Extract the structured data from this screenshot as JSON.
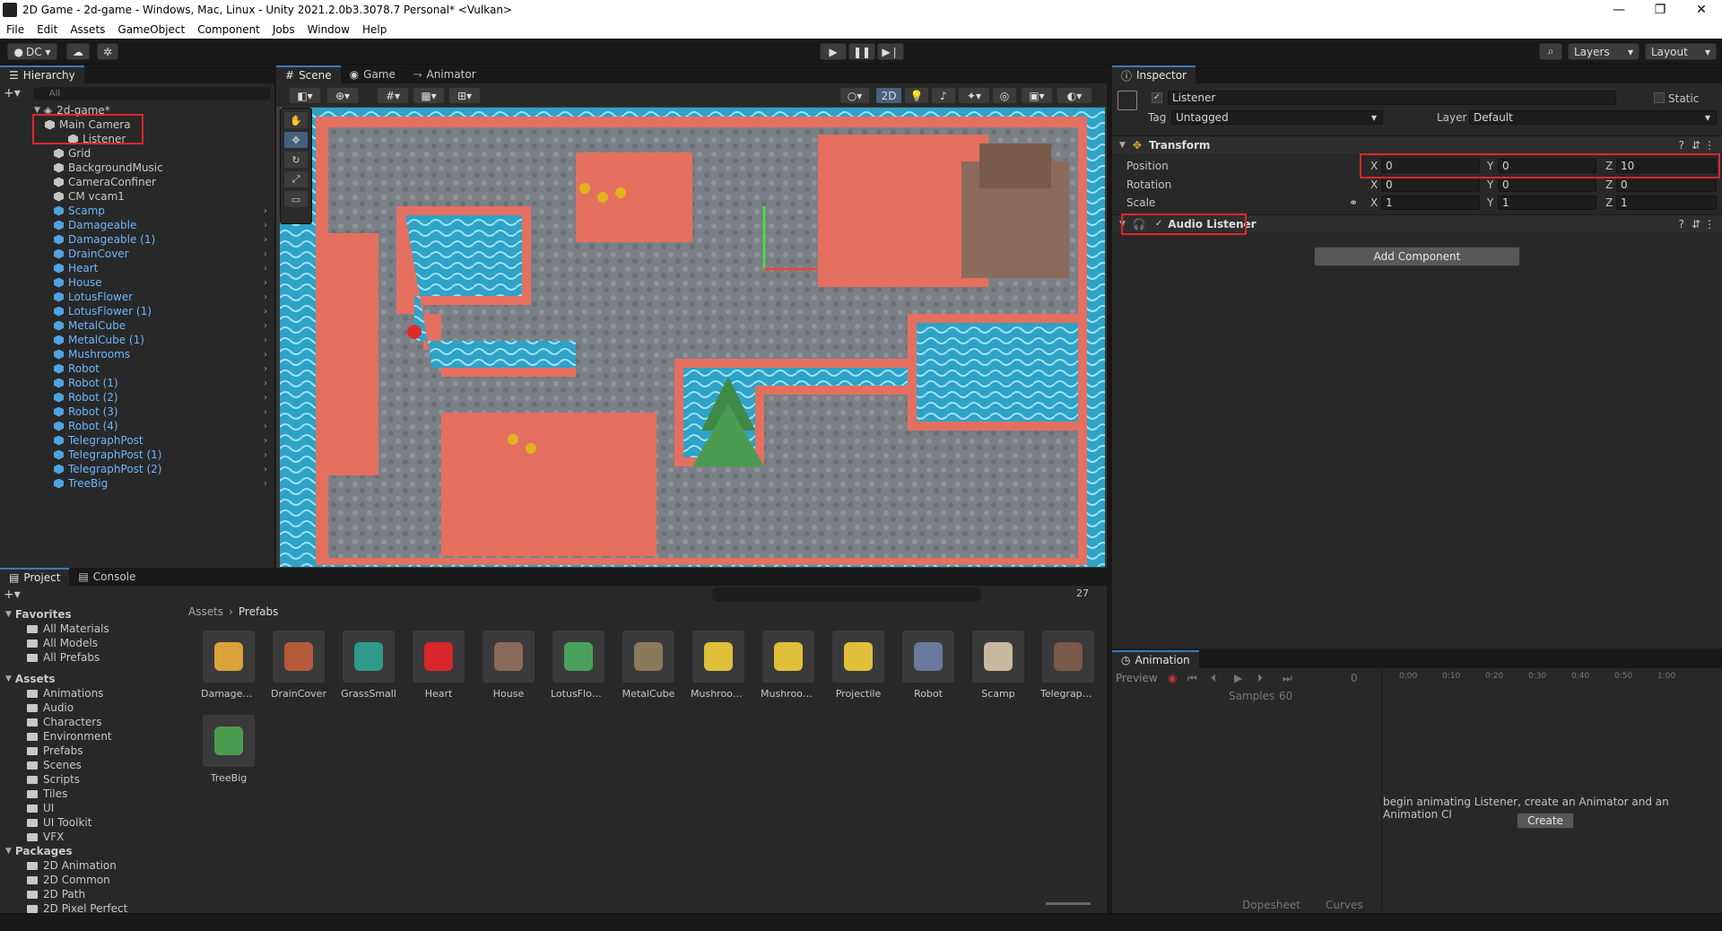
{
  "window": {
    "title": "2D Game - 2d-game - Windows, Mac, Linux - Unity 2021.2.0b3.3078.7 Personal* <Vulkan>",
    "controls": [
      "—",
      "❐",
      "✕"
    ]
  },
  "menu": [
    "File",
    "Edit",
    "Assets",
    "GameObject",
    "Component",
    "Jobs",
    "Window",
    "Help"
  ],
  "toolbar": {
    "account": "DC ▾",
    "layers": "Layers",
    "layout": "Layout"
  },
  "hierarchy": {
    "tab": "Hierarchy",
    "search_placeholder": "All",
    "scene": "2d-game*",
    "items": [
      {
        "label": "Main Camera",
        "prefab": false
      },
      {
        "label": "Listener",
        "prefab": false
      },
      {
        "label": "Grid",
        "prefab": false
      },
      {
        "label": "BackgroundMusic",
        "prefab": false
      },
      {
        "label": "CameraConfiner",
        "prefab": false
      },
      {
        "label": "CM vcam1",
        "prefab": false
      },
      {
        "label": "Scamp",
        "prefab": true
      },
      {
        "label": "Damageable",
        "prefab": true
      },
      {
        "label": "Damageable (1)",
        "prefab": true
      },
      {
        "label": "DrainCover",
        "prefab": true
      },
      {
        "label": "Heart",
        "prefab": true
      },
      {
        "label": "House",
        "prefab": true
      },
      {
        "label": "LotusFlower",
        "prefab": true
      },
      {
        "label": "LotusFlower (1)",
        "prefab": true
      },
      {
        "label": "MetalCube",
        "prefab": true
      },
      {
        "label": "MetalCube (1)",
        "prefab": true
      },
      {
        "label": "Mushrooms",
        "prefab": true
      },
      {
        "label": "Robot",
        "prefab": true
      },
      {
        "label": "Robot (1)",
        "prefab": true
      },
      {
        "label": "Robot (2)",
        "prefab": true
      },
      {
        "label": "Robot (3)",
        "prefab": true
      },
      {
        "label": "Robot (4)",
        "prefab": true
      },
      {
        "label": "TelegraphPost",
        "prefab": true
      },
      {
        "label": "TelegraphPost (1)",
        "prefab": true
      },
      {
        "label": "TelegraphPost (2)",
        "prefab": true
      },
      {
        "label": "TreeBig",
        "prefab": true
      }
    ]
  },
  "scene_tabs": [
    "Scene",
    "Game",
    "Animator"
  ],
  "scene_toolbar": {
    "mode2d": "2D"
  },
  "inspector": {
    "tab": "Inspector",
    "object_name": "Listener",
    "static_label": "Static",
    "tag_label": "Tag",
    "tag_value": "Untagged",
    "layer_label": "Layer",
    "layer_value": "Default",
    "transform": {
      "title": "Transform",
      "position_label": "Position",
      "rotation_label": "Rotation",
      "scale_label": "Scale",
      "position": {
        "x": "0",
        "y": "0",
        "z": "10"
      },
      "rotation": {
        "x": "0",
        "y": "0",
        "z": "0"
      },
      "scale": {
        "x": "1",
        "y": "1",
        "z": "1"
      }
    },
    "audio_listener": "Audio Listener",
    "add_component": "Add Component"
  },
  "project": {
    "tabs": [
      "Project",
      "Console"
    ],
    "favorites_title": "Favorites",
    "favorites": [
      "All Materials",
      "All Models",
      "All Prefabs"
    ],
    "assets_title": "Assets",
    "asset_folders": [
      "Animations",
      "Audio",
      "Characters",
      "Environment",
      "Prefabs",
      "Scenes",
      "Scripts",
      "Tiles",
      "UI",
      "UI Toolkit",
      "VFX"
    ],
    "packages_title": "Packages",
    "packages": [
      "2D Animation",
      "2D Common",
      "2D Path",
      "2D Pixel Perfect"
    ],
    "breadcrumb": [
      "Assets",
      "Prefabs"
    ],
    "hidden_count": "27",
    "prefabs": [
      "Damageab...",
      "DrainCover",
      "GrassSmall",
      "Heart",
      "House",
      "LotusFlow...",
      "MetalCube",
      "Mushroom...",
      "Mushrooms",
      "Projectile",
      "Robot",
      "Scamp",
      "Telegraph...",
      "TreeBig"
    ]
  },
  "animation": {
    "tab": "Animation",
    "preview": "Preview",
    "frame": "0",
    "samples_label": "Samples",
    "samples_value": "60",
    "timeline": [
      "0:00",
      "0:10",
      "0:20",
      "0:30",
      "0:40",
      "0:50",
      "1:00"
    ],
    "message": "begin animating Listener, create an Animator and an Animation Cl",
    "create": "Create",
    "dopesheet": "Dopesheet",
    "curves": "Curves"
  }
}
